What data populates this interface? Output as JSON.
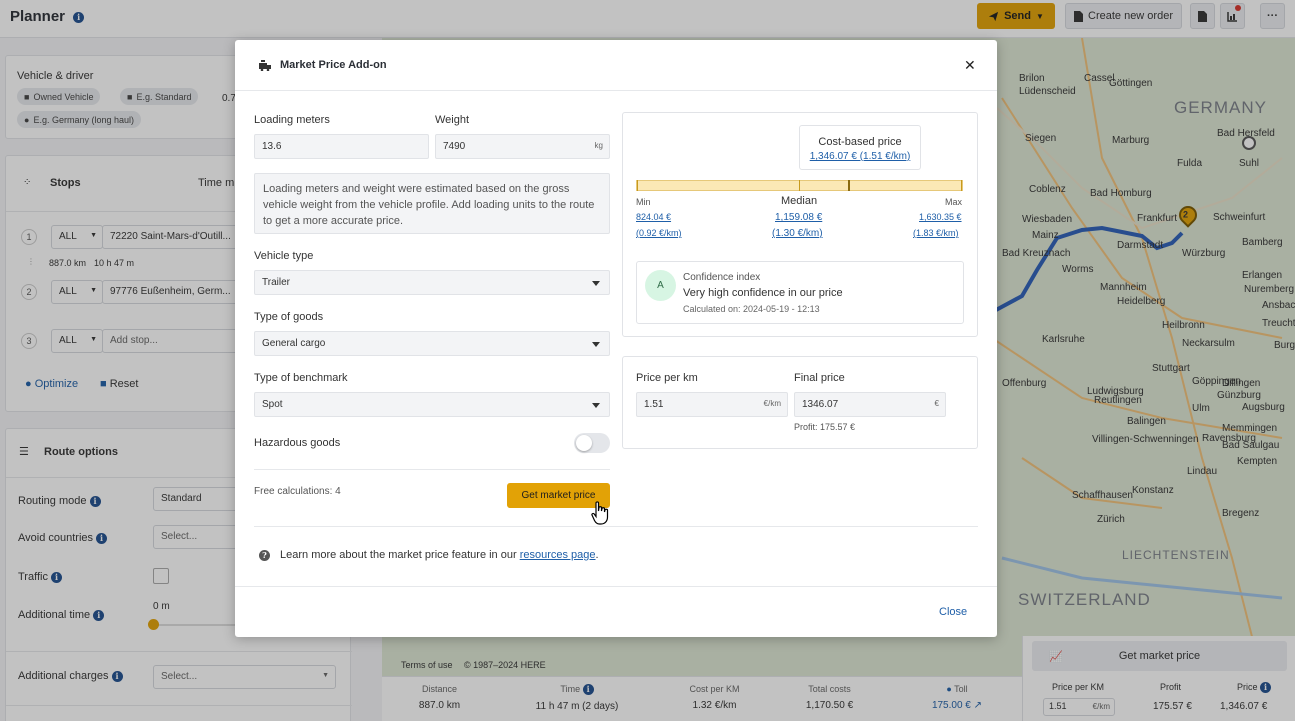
{
  "app": {
    "title": "Planner",
    "send_label": "Send",
    "create_order_label": "Create new order"
  },
  "sidebar": {
    "vehicle_title": "Vehicle & driver",
    "chip_owned": "Owned Vehicle",
    "chip_standard": "E.g. Standard",
    "chip_driver": "E.g. Germany (long haul)",
    "partial_value": "0.7",
    "stops_title": "Stops",
    "time_label": "Time m",
    "stops": [
      {
        "num": "1",
        "type": "ALL",
        "address": "72220 Saint-Mars-d'Outill..."
      },
      {
        "num": "2",
        "type": "ALL",
        "address": "97776 Eußenheim, Germ..."
      },
      {
        "num": "3",
        "type": "ALL",
        "address": "Add stop..."
      }
    ],
    "leg_distance": "887.0 km",
    "leg_time": "10 h 47 m",
    "optimize_label": "Optimize",
    "reset_label": "Reset",
    "route_options_title": "Route options",
    "routing_mode_label": "Routing mode",
    "routing_mode_value": "Standard",
    "avoid_countries_label": "Avoid countries",
    "avoid_countries_value": "Select...",
    "traffic_label": "Traffic",
    "additional_time_label": "Additional time",
    "additional_time_value": "0 m",
    "additional_charges_label": "Additional charges",
    "additional_charges_value": "Select..."
  },
  "map": {
    "cities": [
      "Göttingen",
      "Cassel",
      "Brilon",
      "Lüdenscheid",
      "Siegen",
      "Marburg",
      "Bad Hersfeld",
      "Fulda",
      "Suhl",
      "Coblenz",
      "Bad Homburg",
      "Wiesbaden",
      "Frankfurt",
      "Schweinfurt",
      "Darmstadt",
      "Bamberg",
      "Würzburg",
      "Mannheim",
      "Heidelberg",
      "Erlangen",
      "Nuremberg",
      "Karlsruhe",
      "Heilbronn",
      "Stuttgart",
      "Göppingen",
      "Ludwigsburg",
      "Reutlingen",
      "Ulm",
      "Augsburg",
      "Villingen-Schwenningen",
      "Konstanz",
      "Zürich",
      "Bregenz",
      "Lindau",
      "Kempten",
      "Schaffhausen",
      "Bad Kreuznach",
      "Bad Saulgau",
      "Burg",
      "Ravensburg",
      "Mainz",
      "Worms",
      "Offenburg",
      "Balingen",
      "Neckarsulm",
      "Treuchtlingen",
      "Ansbach",
      "Dillingen",
      "Günzburg",
      "Memmingen"
    ],
    "countries": [
      "GERMANY",
      "SWITZERLAND",
      "LIECHTENSTEIN"
    ],
    "stop_marker": "2",
    "terms_label": "Terms of use",
    "copyright": "© 1987–2024 HERE"
  },
  "footer": {
    "distance_label": "Distance",
    "distance_value": "887.0 km",
    "time_label": "Time",
    "time_value": "11 h 47 m  (2 days)",
    "cost_per_km_label": "Cost per KM",
    "cost_per_km_value": "1.32 €/km",
    "total_costs_label": "Total costs",
    "total_costs_value": "1,170.50 €",
    "toll_label": "Toll",
    "toll_value": "175.00 €"
  },
  "right_panel": {
    "get_market_price_label": "Get market price",
    "price_per_km_label": "Price per KM",
    "price_per_km_value": "1.51",
    "price_per_km_unit": "€/km",
    "profit_label": "Profit",
    "profit_value": "175.57 €",
    "price_label": "Price",
    "price_value": "1,346.07 €"
  },
  "modal": {
    "title": "Market Price Add-on",
    "loading_meters_label": "Loading meters",
    "loading_meters_value": "13.6",
    "weight_label": "Weight",
    "weight_value": "7490",
    "weight_unit": "kg",
    "note": "Loading meters and weight were estimated based on the gross vehicle weight from the vehicle profile. Add loading units to the route to get a more accurate price.",
    "vehicle_type_label": "Vehicle type",
    "vehicle_type_value": "Trailer",
    "goods_type_label": "Type of goods",
    "goods_type_value": "General cargo",
    "benchmark_label": "Type of benchmark",
    "benchmark_value": "Spot",
    "hazardous_label": "Hazardous goods",
    "free_calc_label": "Free calculations: 4",
    "get_price_label": "Get market price",
    "learn_more_text": "Learn more about the market price feature in our ",
    "learn_more_link": "resources page",
    "learn_more_end": ".",
    "close_label": "Close",
    "cost_based": {
      "title": "Cost-based price",
      "value": "1,346.07 € (1.51 €/km)"
    },
    "range": {
      "min_label": "Min",
      "median_label": "Median",
      "max_label": "Max",
      "min_value": "824.04 €",
      "min_per_km": "(0.92 €/km)",
      "median_value": "1,159.08 €",
      "median_per_km": "(1.30 €/km)",
      "max_value": "1,630.35 €",
      "max_per_km": "(1.83 €/km)"
    },
    "confidence": {
      "grade": "A",
      "title": "Confidence index",
      "text": "Very high confidence in our price",
      "calculated": "Calculated on: 2024-05-19 - 12:13"
    },
    "price_per_km_label": "Price per km",
    "price_per_km_value": "1.51",
    "price_per_km_unit": "€/km",
    "final_price_label": "Final price",
    "final_price_value": "1346.07",
    "final_price_unit": "€",
    "profit_text": "Profit: 175.57 €"
  }
}
